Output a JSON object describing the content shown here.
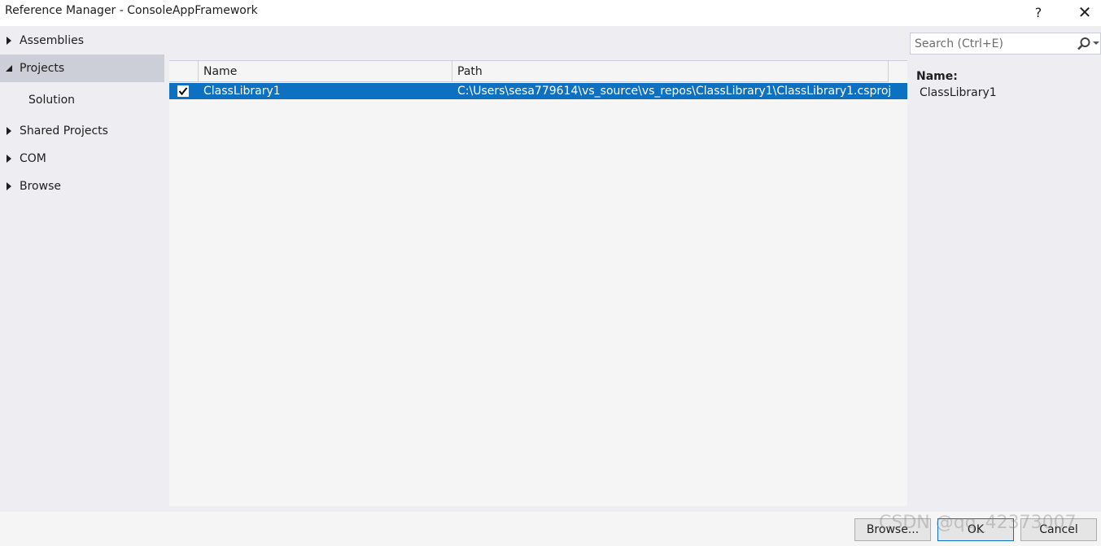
{
  "window": {
    "title": "Reference Manager - ConsoleAppFramework",
    "help_label": "?",
    "close_label": "✕"
  },
  "sidebar": {
    "items": [
      {
        "label": "Assemblies",
        "state": "collapsed"
      },
      {
        "label": "Projects",
        "state": "expanded",
        "selected": true
      },
      {
        "label": "Solution",
        "state": "child"
      },
      {
        "label": "Shared Projects",
        "state": "collapsed"
      },
      {
        "label": "COM",
        "state": "collapsed"
      },
      {
        "label": "Browse",
        "state": "collapsed"
      }
    ]
  },
  "grid": {
    "columns": [
      "Name",
      "Path"
    ],
    "rows": [
      {
        "checked": true,
        "name": "ClassLibrary1",
        "path": "C:\\Users\\sesa779614\\vs_source\\vs_repos\\ClassLibrary1\\ClassLibrary1.csproj"
      }
    ]
  },
  "search": {
    "placeholder": "Search (Ctrl+E)",
    "value": ""
  },
  "details": {
    "name_label": "Name:",
    "name_value": "ClassLibrary1"
  },
  "footer": {
    "browse_label": "Browse...",
    "ok_label": "OK",
    "cancel_label": "Cancel"
  },
  "watermark": "CSDN @qq_42373007",
  "colors": {
    "accent": "#0e70c0",
    "selected_nav": "#ccced8",
    "background": "#eeeef2"
  }
}
